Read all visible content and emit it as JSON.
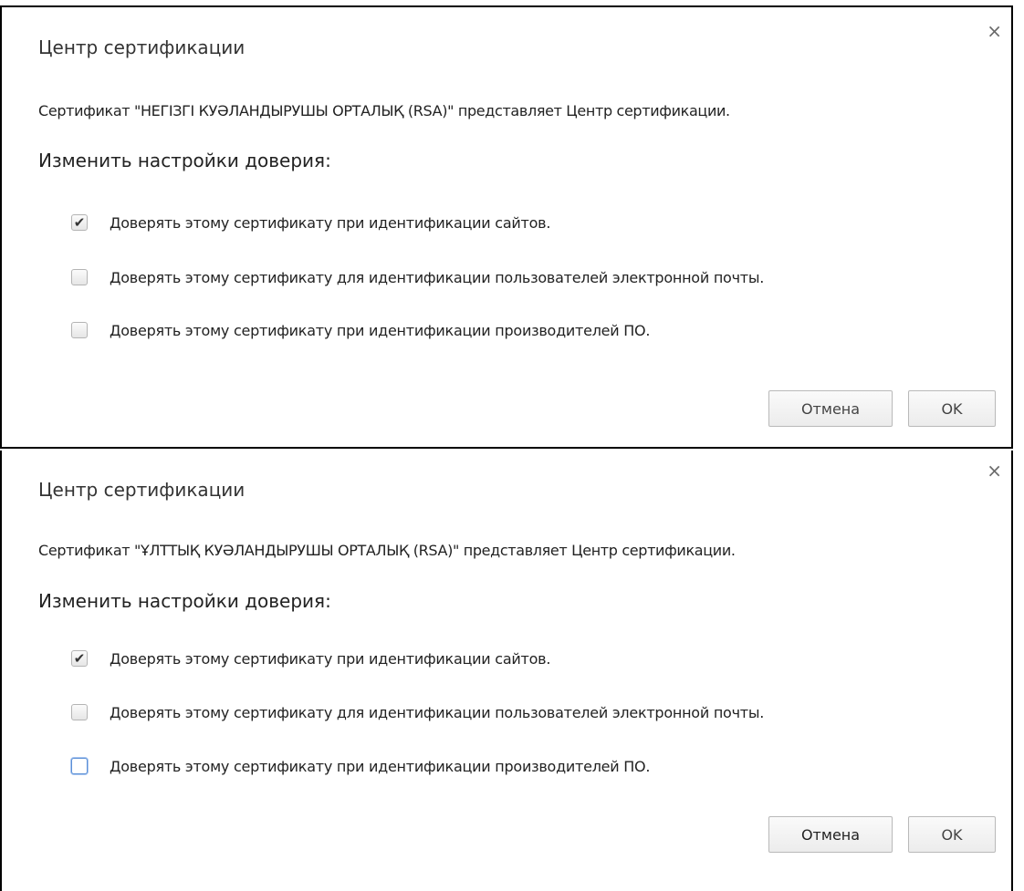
{
  "dialogs": [
    {
      "close_glyph": "×",
      "title": "Центр сертификации",
      "info": "Сертификат \"НЕГІЗГІ КУӘЛАНДЫРУШЫ ОРТАЛЫҚ (RSA)\" представляет Центр сертификации.",
      "section_title": "Изменить настройки доверия:",
      "options": [
        {
          "label": "Доверять этому сертификату при идентификации сайтов.",
          "checked": true
        },
        {
          "label": "Доверять этому сертификату для идентификации пользователей электронной почты.",
          "checked": false
        },
        {
          "label": "Доверять этому сертификату при идентификации производителей ПО.",
          "checked": false
        }
      ],
      "cancel_label": "Отмена",
      "ok_label": "OK"
    },
    {
      "close_glyph": "×",
      "title": "Центр сертификации",
      "info": "Сертификат \"ҰЛТТЫҚ КУӘЛАНДЫРУШЫ ОРТАЛЫҚ (RSA)\" представляет Центр сертификации.",
      "section_title": "Изменить настройки доверия:",
      "options": [
        {
          "label": "Доверять этому сертификату при идентификации сайтов.",
          "checked": true
        },
        {
          "label": "Доверять этому сертификату для идентификации пользователей электронной почты.",
          "checked": false
        },
        {
          "label": "Доверять этому сертификату при идентификации производителей ПО.",
          "checked": false,
          "focused": true
        }
      ],
      "cancel_label": "Отмена",
      "ok_label": "OK"
    }
  ],
  "checkmark_glyph": "✔",
  "colors": {
    "border": "#000000",
    "focus": "#5b8fd6",
    "text": "#222222"
  }
}
